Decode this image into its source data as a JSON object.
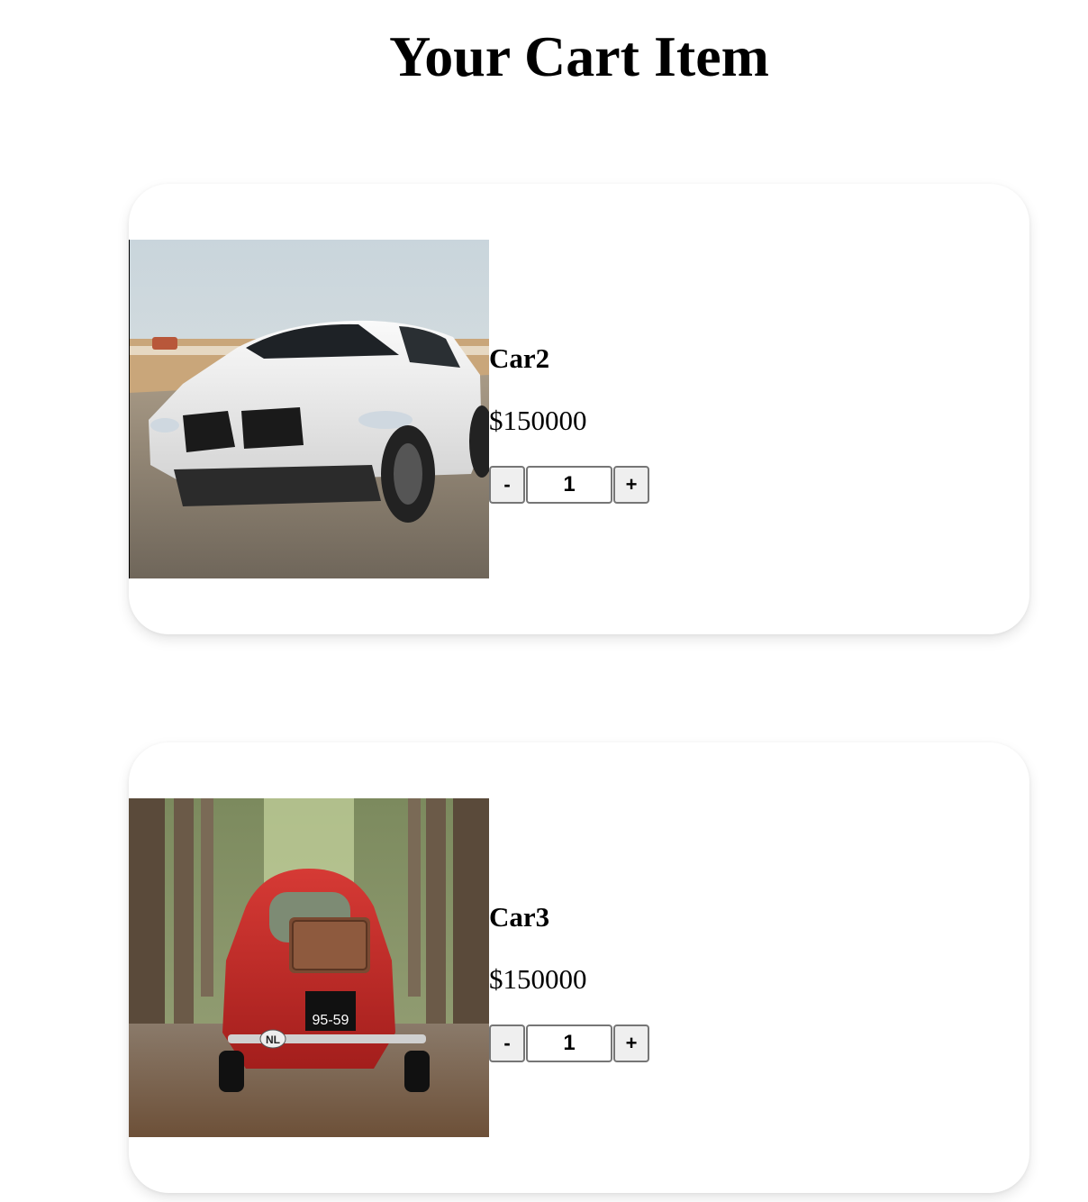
{
  "page": {
    "title": "Your Cart Item"
  },
  "cart": {
    "items": [
      {
        "name": "Car2",
        "price": "$150000",
        "quantity": "1",
        "decrease_label": "-",
        "increase_label": "+",
        "image_alt": "white sedan driving on road"
      },
      {
        "name": "Car3",
        "price": "$150000",
        "quantity": "1",
        "decrease_label": "-",
        "increase_label": "+",
        "image_alt": "red vintage car on tree-lined road",
        "plate_text": "95-59",
        "country_badge": "NL"
      }
    ]
  },
  "colors": {
    "card_bg": "#ffffff",
    "button_bg": "#efefef",
    "button_border": "#767676"
  }
}
